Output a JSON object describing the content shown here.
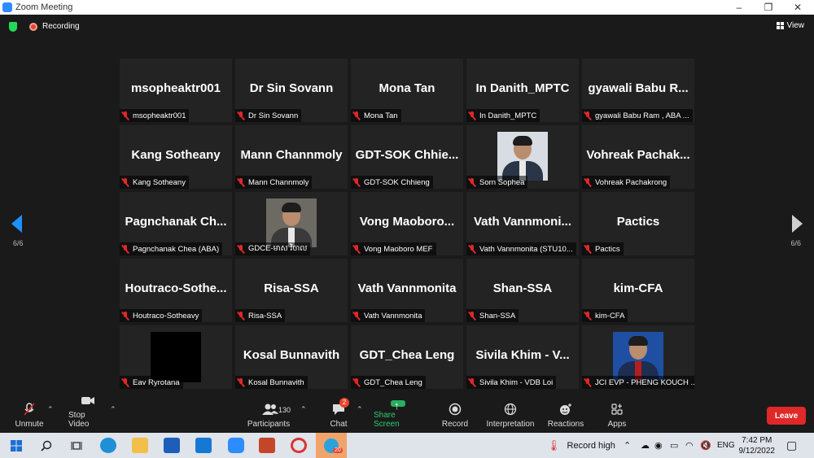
{
  "window": {
    "title": "Zoom Meeting"
  },
  "meeting": {
    "recording_label": "Recording",
    "view_label": "View",
    "page_left": "6/6",
    "page_right": "6/6"
  },
  "tiles": [
    {
      "big": "msopheaktr001",
      "name": "msopheaktr001"
    },
    {
      "big": "Dr Sin Sovann",
      "name": "Dr Sin Sovann"
    },
    {
      "big": "Mona Tan",
      "name": "Mona Tan"
    },
    {
      "big": "In Danith_MPTC",
      "name": "In Danith_MPTC"
    },
    {
      "big": "gyawali  Babu  R...",
      "name": "gyawali Babu Ram , ABA ..."
    },
    {
      "big": "Kang Sotheany",
      "name": "Kang Sotheany"
    },
    {
      "big": "Mann Channmoly",
      "name": "Mann Channmoly"
    },
    {
      "big": "GDT-SOK  Chhie...",
      "name": "GDT-SOK Chhieng"
    },
    {
      "big": "",
      "name": "Sorn Sophea",
      "photo": "light"
    },
    {
      "big": "Vohreak  Pachak...",
      "name": "Vohreak Pachakrong"
    },
    {
      "big": "Pagnchanak  Ch...",
      "name": "Pagnchanak Chea (ABA)"
    },
    {
      "big": "",
      "name": "GDCE-មាស វិចាល",
      "photo": "dark"
    },
    {
      "big": "Vong  Maoboro...",
      "name": "Vong Maoboro MEF"
    },
    {
      "big": "Vath  Vannmoni...",
      "name": "Vath Vannmonita (STU10..."
    },
    {
      "big": "Pactics",
      "name": "Pactics"
    },
    {
      "big": "Houtraco-Sothe...",
      "name": "Houtraco-Sotheavy"
    },
    {
      "big": "Risa-SSA",
      "name": "Risa-SSA"
    },
    {
      "big": "Vath Vannmonita",
      "name": "Vath Vannmonita"
    },
    {
      "big": "Shan-SSA",
      "name": "Shan-SSA"
    },
    {
      "big": "kim-CFA",
      "name": "kim-CFA"
    },
    {
      "big": "",
      "name": "Eav Ryrotana",
      "photo": "black"
    },
    {
      "big": "Kosal Bunnavith",
      "name": "Kosal Bunnavith"
    },
    {
      "big": "GDT_Chea Leng",
      "name": "GDT_Chea Leng"
    },
    {
      "big": "Sivila Khim - V...",
      "name": "Sivila Khim - VDB Loi"
    },
    {
      "big": "",
      "name": "JCI EVP - PHENG KOUCH ...",
      "photo": "blue"
    }
  ],
  "toolbar": {
    "unmute": "Unmute",
    "stop_video": "Stop Video",
    "participants": "Participants",
    "participants_count": "130",
    "chat": "Chat",
    "chat_badge": "2",
    "share_screen": "Share Screen",
    "record": "Record",
    "interpretation": "Interpretation",
    "reactions": "Reactions",
    "apps": "Apps",
    "leave": "Leave"
  },
  "taskbar": {
    "record_high": "Record high",
    "lang": "ENG",
    "time": "7:42 PM",
    "date": "9/12/2022",
    "notif_badge": "20"
  },
  "colors": {
    "accent": "#2d8cff",
    "leave": "#e02828",
    "share": "#27ae60",
    "muted_mic": "#e02828"
  }
}
